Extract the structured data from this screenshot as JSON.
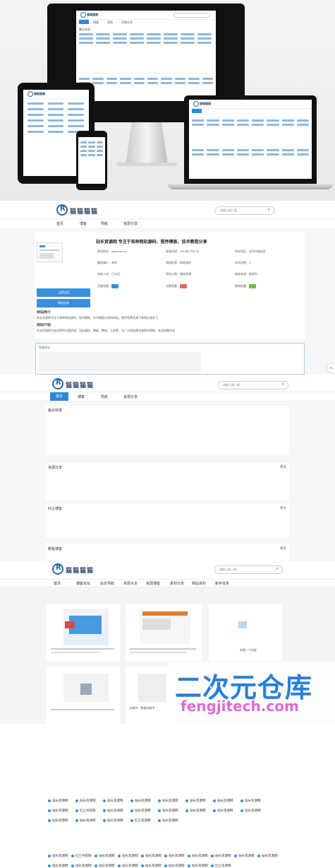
{
  "brand": {
    "name": "猫猫猫猫"
  },
  "hero": {
    "monitor_nav": [
      "首页",
      "博客",
      "导航",
      "资源分享"
    ],
    "mini_section": "最近收录"
  },
  "page2": {
    "search_placeholder": "请输入搜一搜",
    "nav": [
      "首页",
      "博客",
      "导航",
      "资源分享"
    ],
    "site_title": "站长资源网 专注于各种网站源码、程序模板、技术教程分享",
    "meta": [
      {
        "label": "网站地址：",
        "value": "www.xxx.cn"
      },
      {
        "label": "收录时间：",
        "value": "2019年7月27日"
      },
      {
        "label": "所在地区：",
        "value": "北京市海淀区"
      },
      {
        "label": "服务器IP：",
        "value": "未知"
      },
      {
        "label": "网站标签：",
        "value": "网站源码"
      },
      {
        "label": "访问次数：",
        "value": "1"
      },
      {
        "label": "浏览人次：",
        "value": "已认证"
      },
      {
        "label": "网站分类：",
        "value": "建站资源"
      },
      {
        "label": "收录状态：",
        "value": "收录中"
      }
    ],
    "badge_labels": [
      "百度权重：",
      "谷歌权重：",
      "搜狗权重："
    ],
    "buttons": [
      "立即访问",
      "网站反馈"
    ],
    "intro_title": "网站简介",
    "intro_text": "站长资源网专注于各种网站源码、程序模板、技术教程分享的网站，提供免费资源下载和交流学习",
    "info_title": "网站介绍",
    "info_text": "站长资源网为站长提供丰富资源，包括源码、模板、教程、工具等，为广大网站建设者提供帮助，欢迎收藏本站",
    "comment_title": "发表评论"
  },
  "page3": {
    "search_placeholder": "请输入搜一搜",
    "nav": [
      "首页",
      "博客",
      "导航",
      "资源分享"
    ],
    "recent_title": "最近收录",
    "recent_items": [
      "站长资源网",
      "站长资源网",
      "站长资源网",
      "站长资源网",
      "站长资源网",
      "站长资源网",
      "站长资源网",
      "站长资源网",
      "站长资源网",
      "红尘导航网",
      "站长资源网",
      "站长资源网",
      "站长资源网",
      "站长资源网",
      "站长资源网",
      "站长资源网",
      "站长资源网",
      "站长资源网",
      "站长资源网",
      "红尘资源网",
      "站长资源网"
    ],
    "share_title": "资源分享",
    "share_items": [
      "站长资源网",
      "红尘导航网",
      "站长资源网",
      "站长资源网",
      "站长资源网",
      "站长资源网",
      "站长资源网",
      "站长资源网",
      "站长资源网",
      "站长资源网",
      "站长资源网",
      "站长资源网",
      "站长资源网",
      "站长资源网",
      "站长资源网",
      "站长资源网",
      "站长资源网",
      "红尘资源网"
    ],
    "panel2_title": "红尘博客",
    "panel3_title": "教程博客",
    "more": "更多"
  },
  "page4": {
    "search_placeholder": "请输入搜一搜",
    "nav": [
      "首页",
      "博客论坛",
      "站长导航",
      "资源大全",
      "资源博客",
      "素材分享",
      "网站百科",
      "新手任务"
    ],
    "caption_1": "给我一个机会",
    "card3_text": "加载中 - 数据加载中"
  },
  "watermark": {
    "big": "二次元仓库",
    "small": "fengjitech.com"
  },
  "colors": {
    "accent": "#2a8ad8",
    "brand": "#2b6aa3"
  }
}
